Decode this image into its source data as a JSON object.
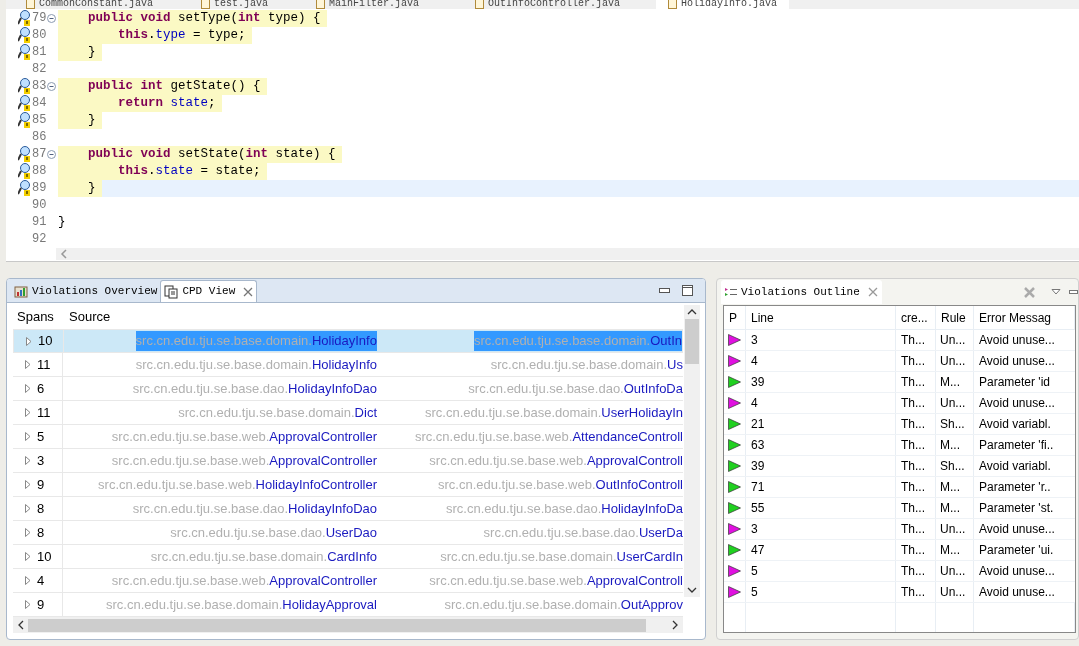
{
  "editor": {
    "tabs": [
      {
        "label": "CommonConstant.java",
        "selected": false
      },
      {
        "label": "test.java",
        "selected": false
      },
      {
        "label": "MainFilter.java",
        "selected": false
      },
      {
        "label": "OutInfoController.java",
        "selected": false
      },
      {
        "label": "HolidayInfo.java",
        "selected": true
      }
    ],
    "lines": [
      {
        "number": "79",
        "kind": "member",
        "marker": true,
        "fold": true,
        "highlighted": true,
        "current": false,
        "segments": [
          {
            "kind": "kw",
            "text": "public void"
          },
          {
            "kind": "plain",
            "text": " setType("
          },
          {
            "kind": "kw",
            "text": "int"
          },
          {
            "kind": "plain",
            "text": " type) {"
          }
        ]
      },
      {
        "number": "80",
        "kind": "body",
        "marker": true,
        "fold": false,
        "highlighted": true,
        "current": false,
        "segments": [
          {
            "kind": "kw",
            "text": "this"
          },
          {
            "kind": "plain",
            "text": "."
          },
          {
            "kind": "field",
            "text": "type"
          },
          {
            "kind": "plain",
            "text": " = type;"
          }
        ]
      },
      {
        "number": "81",
        "kind": "member",
        "marker": true,
        "fold": false,
        "highlighted": true,
        "current": false,
        "segments": [
          {
            "kind": "plain",
            "text": "}"
          }
        ]
      },
      {
        "number": "82",
        "kind": "top",
        "marker": false,
        "fold": false
      },
      {
        "number": "83",
        "kind": "member",
        "marker": true,
        "fold": true,
        "highlighted": true,
        "current": false,
        "segments": [
          {
            "kind": "kw",
            "text": "public int"
          },
          {
            "kind": "plain",
            "text": " getState() {"
          }
        ]
      },
      {
        "number": "84",
        "kind": "body",
        "marker": true,
        "fold": false,
        "highlighted": true,
        "current": false,
        "segments": [
          {
            "kind": "kw",
            "text": "return"
          },
          {
            "kind": "field",
            "text": " state"
          },
          {
            "kind": "plain",
            "text": ";"
          }
        ]
      },
      {
        "number": "85",
        "kind": "member",
        "marker": true,
        "fold": false,
        "highlighted": true,
        "current": false,
        "segments": [
          {
            "kind": "plain",
            "text": "}"
          }
        ]
      },
      {
        "number": "86",
        "kind": "top",
        "marker": false,
        "fold": false
      },
      {
        "number": "87",
        "kind": "member",
        "marker": true,
        "fold": true,
        "highlighted": true,
        "current": false,
        "segments": [
          {
            "kind": "kw",
            "text": "public void"
          },
          {
            "kind": "plain",
            "text": " setState("
          },
          {
            "kind": "kw",
            "text": "int"
          },
          {
            "kind": "plain",
            "text": " state) {"
          }
        ]
      },
      {
        "number": "88",
        "kind": "body",
        "marker": true,
        "fold": false,
        "highlighted": true,
        "current": false,
        "segments": [
          {
            "kind": "kw",
            "text": "this"
          },
          {
            "kind": "plain",
            "text": "."
          },
          {
            "kind": "field",
            "text": "state"
          },
          {
            "kind": "plain",
            "text": " = state;"
          }
        ]
      },
      {
        "number": "89",
        "kind": "member",
        "marker": true,
        "fold": false,
        "highlighted": true,
        "current": true,
        "segments": [
          {
            "kind": "plain",
            "text": "}"
          }
        ]
      },
      {
        "number": "90",
        "kind": "top",
        "marker": false,
        "fold": false
      },
      {
        "number": "91",
        "kind": "top",
        "marker": false,
        "fold": false,
        "highlighted": false,
        "current": false,
        "segments": [
          {
            "kind": "plain",
            "text": "}"
          }
        ]
      },
      {
        "number": "92",
        "kind": "top",
        "marker": false,
        "fold": false
      }
    ]
  },
  "cpd_panel": {
    "tabs": [
      {
        "label": "Violations Overview",
        "selected": false,
        "closable": false
      },
      {
        "label": "CPD View",
        "selected": true,
        "closable": true
      }
    ],
    "columns": [
      "Spans",
      "Source"
    ],
    "rows": [
      {
        "spans": "10",
        "selected": true,
        "left_package": "src.cn.edu.tju.se.base.domain.",
        "left_class": "HolidayInfo",
        "right_package": "src.cn.edu.tju.se.base.domain.",
        "right_class": "OutIn"
      },
      {
        "spans": "11",
        "selected": false,
        "left_package": "src.cn.edu.tju.se.base.domain.",
        "left_class": "HolidayInfo",
        "right_package": "src.cn.edu.tju.se.base.domain.",
        "right_class": "Us"
      },
      {
        "spans": "6",
        "selected": false,
        "left_package": "src.cn.edu.tju.se.base.dao.",
        "left_class": "HolidayInfoDao",
        "right_package": "src.cn.edu.tju.se.base.dao.",
        "right_class": "OutInfoDa"
      },
      {
        "spans": "11",
        "selected": false,
        "left_package": "src.cn.edu.tju.se.base.domain.",
        "left_class": "Dict",
        "right_package": "src.cn.edu.tju.se.base.domain.",
        "right_class": "UserHolidayIn"
      },
      {
        "spans": "5",
        "selected": false,
        "left_package": "src.cn.edu.tju.se.base.web.",
        "left_class": "ApprovalController",
        "right_package": "src.cn.edu.tju.se.base.web.",
        "right_class": "AttendanceControll"
      },
      {
        "spans": "3",
        "selected": false,
        "left_package": "src.cn.edu.tju.se.base.web.",
        "left_class": "ApprovalController",
        "right_package": "src.cn.edu.tju.se.base.web.",
        "right_class": "ApprovalControll"
      },
      {
        "spans": "9",
        "selected": false,
        "left_package": "src.cn.edu.tju.se.base.web.",
        "left_class": "HolidayInfoController",
        "right_package": "src.cn.edu.tju.se.base.web.",
        "right_class": "OutInfoControll"
      },
      {
        "spans": "8",
        "selected": false,
        "left_package": "src.cn.edu.tju.se.base.dao.",
        "left_class": "HolidayInfoDao",
        "right_package": "src.cn.edu.tju.se.base.dao.",
        "right_class": "HolidayInfoDa"
      },
      {
        "spans": "8",
        "selected": false,
        "left_package": "src.cn.edu.tju.se.base.dao.",
        "left_class": "UserDao",
        "right_package": "src.cn.edu.tju.se.base.dao.",
        "right_class": "UserDa"
      },
      {
        "spans": "10",
        "selected": false,
        "left_package": "src.cn.edu.tju.se.base.domain.",
        "left_class": "CardInfo",
        "right_package": "src.cn.edu.tju.se.base.domain.",
        "right_class": "UserCardIn"
      },
      {
        "spans": "4",
        "selected": false,
        "left_package": "src.cn.edu.tju.se.base.web.",
        "left_class": "ApprovalController",
        "right_package": "src.cn.edu.tju.se.base.web.",
        "right_class": "ApprovalControll"
      },
      {
        "spans": "9",
        "selected": false,
        "left_package": "src.cn.edu.tju.se.base.domain.",
        "left_class": "HolidayApproval",
        "right_package": "src.cn.edu.tju.se.base.domain.",
        "right_class": "OutApprov"
      }
    ]
  },
  "outline_panel": {
    "title": "Violations Outline",
    "columns": [
      "P",
      "Line",
      "cre...",
      "Rule",
      "Error Messag"
    ],
    "rows": [
      {
        "color": "#e010e0",
        "line": "3",
        "column_3": "Th...",
        "rule": "Un...",
        "message": "Avoid unuse..."
      },
      {
        "color": "#e010e0",
        "line": "4",
        "column_3": "Th...",
        "rule": "Un...",
        "message": "Avoid unuse..."
      },
      {
        "color": "#20d020",
        "line": "39",
        "column_3": "Th...",
        "rule": "M...",
        "message": "Parameter 'id"
      },
      {
        "color": "#e010e0",
        "line": "4",
        "column_3": "Th...",
        "rule": "Un...",
        "message": "Avoid unuse..."
      },
      {
        "color": "#20d020",
        "line": "21",
        "column_3": "Th...",
        "rule": "Sh...",
        "message": "Avoid variabl."
      },
      {
        "color": "#20d020",
        "line": "63",
        "column_3": "Th...",
        "rule": "M...",
        "message": "Parameter 'fi.."
      },
      {
        "color": "#20d020",
        "line": "39",
        "column_3": "Th...",
        "rule": "Sh...",
        "message": "Avoid variabl."
      },
      {
        "color": "#20d020",
        "line": "71",
        "column_3": "Th...",
        "rule": "M...",
        "message": "Parameter 'r.."
      },
      {
        "color": "#20d020",
        "line": "55",
        "column_3": "Th...",
        "rule": "M...",
        "message": "Parameter 'st."
      },
      {
        "color": "#e010e0",
        "line": "3",
        "column_3": "Th...",
        "rule": "Un...",
        "message": "Avoid unuse..."
      },
      {
        "color": "#20d020",
        "line": "47",
        "column_3": "Th...",
        "rule": "M...",
        "message": "Parameter 'ui."
      },
      {
        "color": "#e010e0",
        "line": "5",
        "column_3": "Th...",
        "rule": "Un...",
        "message": "Avoid unuse..."
      },
      {
        "color": "#e010e0",
        "line": "5",
        "column_3": "Th...",
        "rule": "Un...",
        "message": "Avoid unuse..."
      }
    ]
  }
}
